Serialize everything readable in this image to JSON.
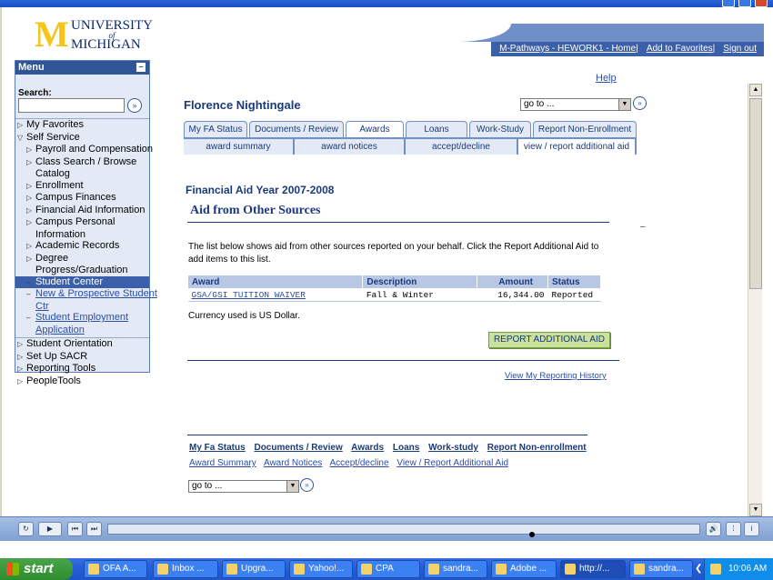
{
  "header": {
    "logo_univ": "UNIVERSITY",
    "logo_of": "of",
    "logo_mich": "MICHIGAN",
    "links": [
      "M-Pathways - HEWORK1 - Home",
      "Add to Favorites",
      "Sign out"
    ]
  },
  "menu": {
    "title": "Menu",
    "search_label": "Search:",
    "items": [
      {
        "label": "My Favorites"
      },
      {
        "label": "Self Service"
      },
      {
        "label": "Payroll and Compensation"
      },
      {
        "label": "Class Search / Browse"
      },
      {
        "label": "Catalog"
      },
      {
        "label": "Enrollment"
      },
      {
        "label": "Campus Finances"
      },
      {
        "label": "Financial Aid Information"
      },
      {
        "label": "Campus Personal"
      },
      {
        "label": "Information"
      },
      {
        "label": "Academic Records"
      },
      {
        "label": "Degree"
      },
      {
        "label": "Progress/Graduation"
      },
      {
        "label": "Student Center"
      },
      {
        "label": "New & Prospective Student"
      },
      {
        "label": "Ctr"
      },
      {
        "label": "Student Employment"
      },
      {
        "label": "Application"
      },
      {
        "label": "Student Orientation"
      },
      {
        "label": "Set Up SACR"
      },
      {
        "label": "Reporting Tools"
      },
      {
        "label": "PeopleTools"
      }
    ]
  },
  "main": {
    "help": "Help",
    "person_name": "Florence Nightingale",
    "goto_value": "go to ...",
    "tabs": [
      "My FA Status",
      "Documents / Review",
      "Awards",
      "Loans",
      "Work-Study",
      "Report Non-Enrollment"
    ],
    "subtabs": [
      "award summary",
      "award notices",
      "accept/decline",
      "view / report additional aid"
    ],
    "fa_year": "Financial Aid Year 2007-2008",
    "section_title": "Aid from Other Sources",
    "dash": "–",
    "intro": "The list below shows aid from other sources reported on your behalf.  Click the Report Additional Aid to add items to this list.",
    "table": {
      "headers": [
        "Award",
        "Description",
        "Amount",
        "Status"
      ],
      "rows": [
        {
          "award": "GSA/GSI TUITION WAIVER",
          "description": "Fall & Winter",
          "amount": "16,344.00",
          "status": "Reported"
        }
      ]
    },
    "currency": "Currency used is US Dollar.",
    "report_button": "REPORT ADDITIONAL AID",
    "history_link": "View My Reporting History",
    "footer_links_1": [
      "My Fa Status",
      "Documents / Review",
      "Awards",
      "Loans",
      "Work-study",
      "Report Non-enrollment"
    ],
    "footer_links_2": [
      "Award Summary",
      "Award Notices",
      "Accept/decline",
      "View / Report Additional Aid"
    ]
  },
  "taskbar": {
    "start": "start",
    "tasks": [
      "OFA A...",
      "Inbox ...",
      "Upgra...",
      "Yahoo!...",
      "CPA",
      "sandra...",
      "Adobe ...",
      "http://...",
      "sandra..."
    ],
    "clock": "10:06 AM"
  },
  "colors": {
    "brand_blue": "#2f5597",
    "maize": "#f5c518",
    "button_green": "#c9e19a"
  }
}
